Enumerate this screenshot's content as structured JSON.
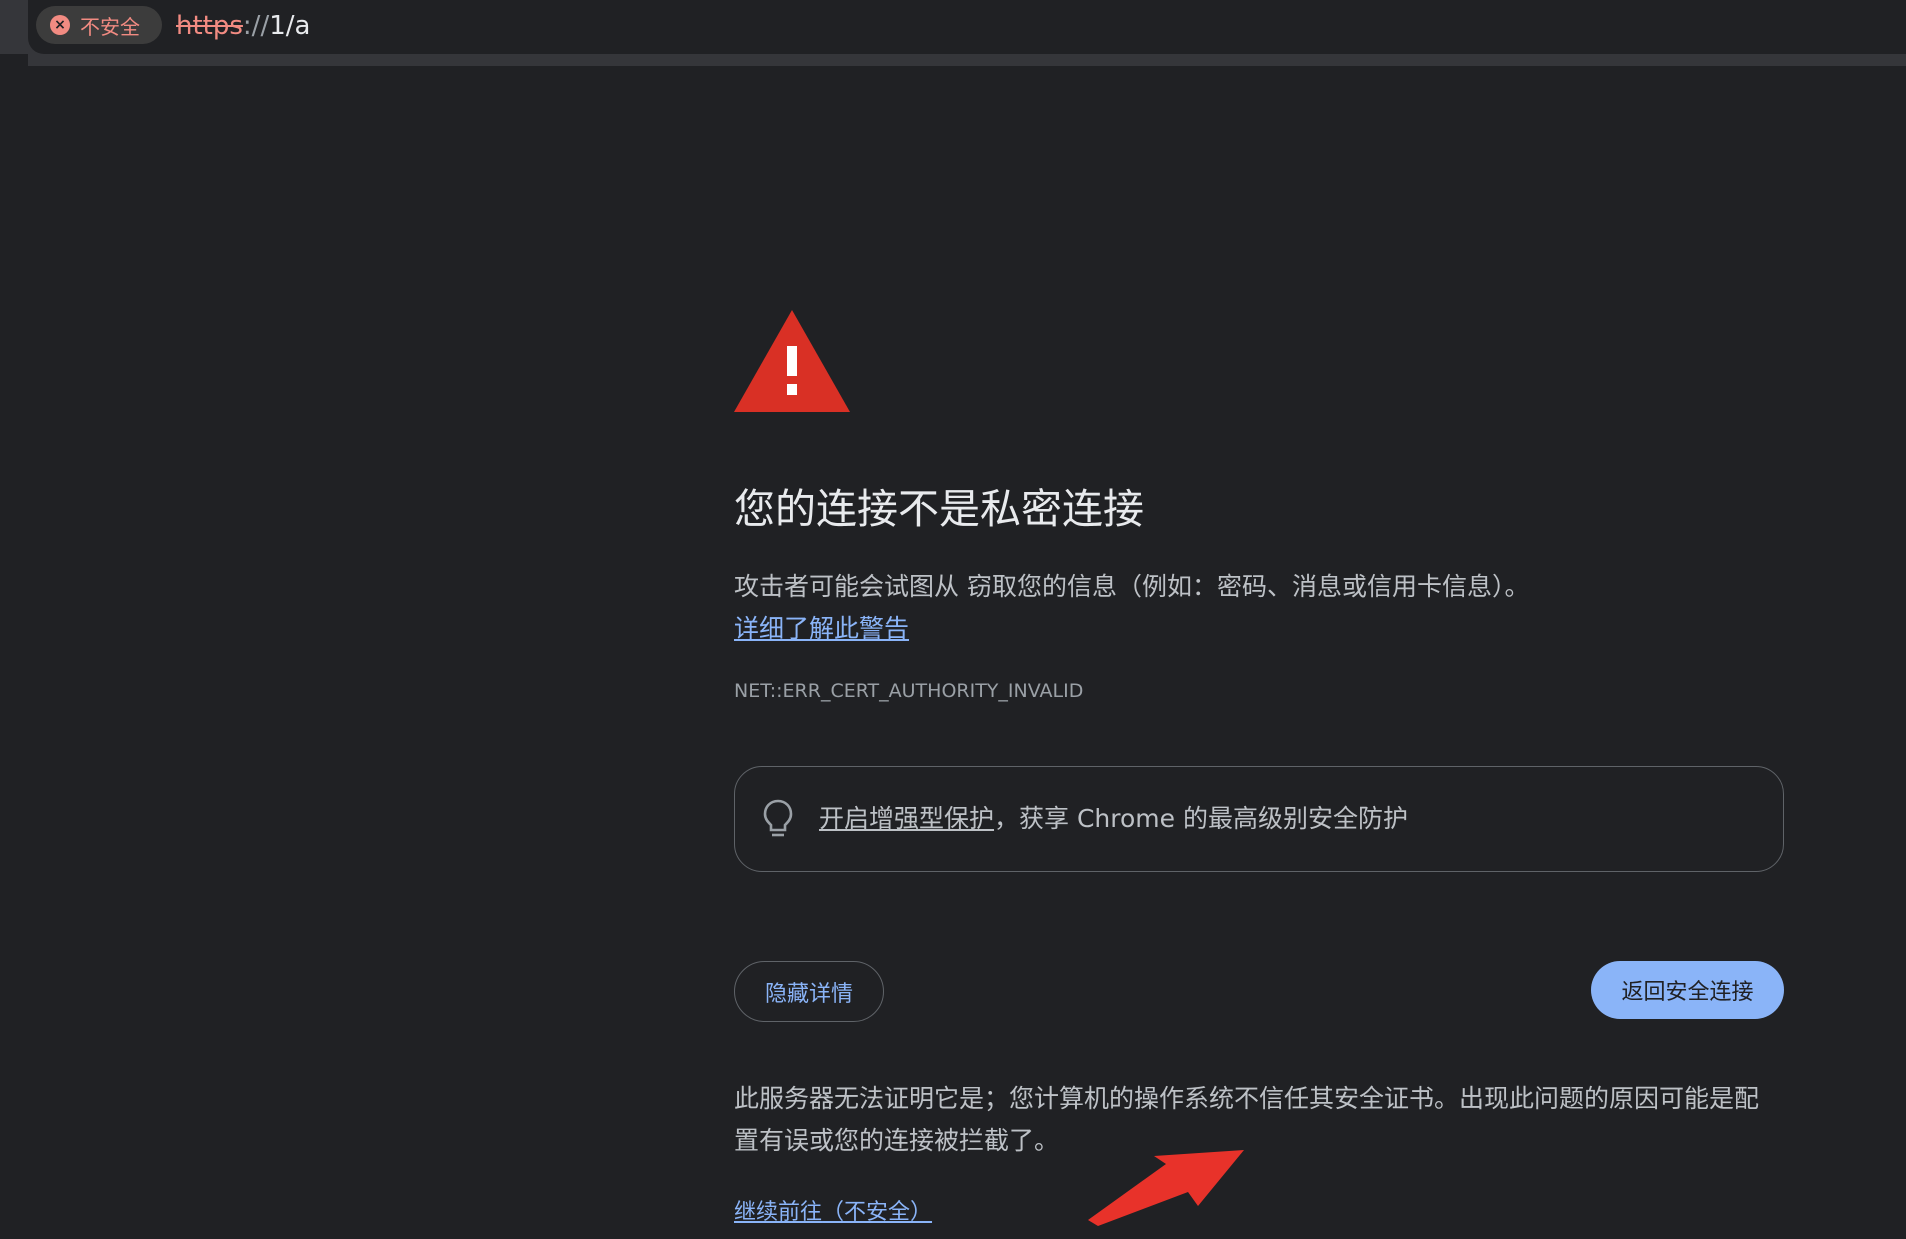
{
  "browser": {
    "security_chip": {
      "label": "不安全",
      "icon": "x-circle-icon",
      "color": "#f28b82"
    },
    "url": {
      "scheme": "https",
      "separator": "://",
      "host": "1",
      "path": "/a"
    }
  },
  "interstitial": {
    "icon": "warning-triangle-icon",
    "title": "您的连接不是私密连接",
    "description_before": "攻击者可能会试图从 ",
    "description_after": " 窃取您的信息（例如：密码、消息或信用卡信息）。",
    "learn_more_link": "详细了解此警告",
    "error_code": "NET::ERR_CERT_AUTHORITY_INVALID",
    "enhanced_protection": {
      "icon": "lightbulb-icon",
      "link_text": "开启增强型保护",
      "text": "，获享 Chrome 的最高级别安全防护"
    },
    "hide_details_button": "隐藏详情",
    "back_to_safety_button": "返回安全连接",
    "details_before": "此服务器无法证明它是",
    "details_after": "；您计算机的操作系统不信任其安全证书。出现此问题的原因可能是配置有误或您的连接被拦截了。",
    "proceed_link_before": "继续前往",
    "proceed_link_after": "（不安全）"
  },
  "colors": {
    "background": "#202124",
    "accent": "#8ab4f8",
    "danger": "#d93025",
    "annotation": "#e8322a"
  }
}
